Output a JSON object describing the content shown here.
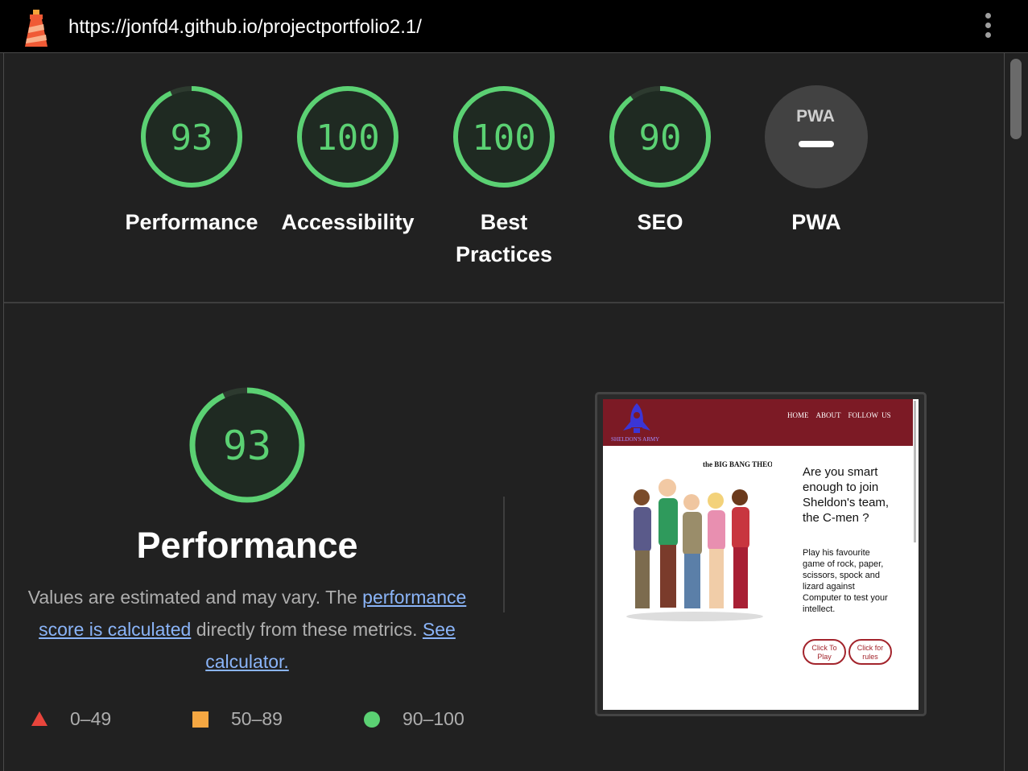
{
  "topbar": {
    "url": "https://jonfd4.github.io/projectportfolio2.1/",
    "icons": [
      "lighthouse-logo-icon",
      "more-vert-icon"
    ]
  },
  "colors": {
    "pass": "#5bd173",
    "average": "#f5a742",
    "fail": "#e8453c",
    "background": "#212121",
    "link": "#8ab4f8"
  },
  "scores": [
    {
      "id": "performance",
      "value": "93",
      "fraction": 0.93,
      "label": "Performance"
    },
    {
      "id": "accessibility",
      "value": "100",
      "fraction": 1.0,
      "label": "Accessibility"
    },
    {
      "id": "best-practices",
      "value": "100",
      "fraction": 1.0,
      "label": "Best Practices"
    },
    {
      "id": "seo",
      "value": "90",
      "fraction": 0.9,
      "label": "SEO"
    },
    {
      "id": "pwa",
      "value": "PWA",
      "label": "PWA"
    }
  ],
  "performance": {
    "score": "93",
    "fraction": 0.93,
    "title": "Performance",
    "desc_before": "Values are estimated and may vary. The ",
    "desc_link1": "performance score is calculated",
    "desc_middle": " directly from these metrics. ",
    "desc_link2": "See calculator."
  },
  "legend": [
    {
      "range": "0–49",
      "shape": "triangle"
    },
    {
      "range": "50–89",
      "shape": "square"
    },
    {
      "range": "90–100",
      "shape": "circle"
    }
  ],
  "screenshot": {
    "brand": "SHELDON'S ARMY",
    "nav": [
      "HOME",
      "ABOUT",
      "FOLLOW US"
    ],
    "show_logo_text": "the BIG BANG THEORY",
    "heading": "Are you smart enough to join Sheldon's team, the C-men ?",
    "body": "Play his favourite game of rock, paper, scissors, spock and lizard against Computer to test your intellect.",
    "btn_play": "Click To Play",
    "btn_rules": "Click for rules"
  }
}
